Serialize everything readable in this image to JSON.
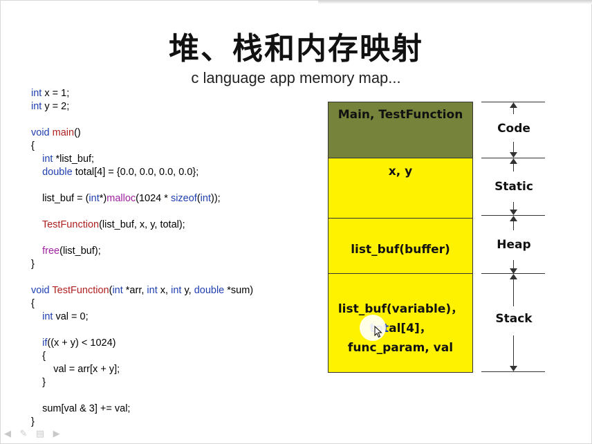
{
  "slide": {
    "title": "堆、栈和内存映射",
    "subtitle": "c language app memory map..."
  },
  "code": {
    "line_01": {
      "t1": "int",
      "t2": " x = 1;"
    },
    "line_02": {
      "t1": "int",
      "t2": " y = 2;"
    },
    "line_04": {
      "t1": "void ",
      "t2": "main",
      "t3": "()"
    },
    "line_05": "{",
    "line_06": {
      "t1": "    int",
      "t2": " *list_buf;"
    },
    "line_07": {
      "t1": "    double",
      "t2": " total[4] = {0.0, 0.0, 0.0, 0.0};"
    },
    "line_09": {
      "t1": "    list_buf = (",
      "t2": "int",
      "t3": "*)",
      "t4": "malloc",
      "t5": "(1024 * ",
      "t6": "sizeof",
      "t7": "(",
      "t8": "int",
      "t9": "));"
    },
    "line_11": {
      "t1": "    ",
      "t2": "TestFunction",
      "t3": "(list_buf, x, y, total);"
    },
    "line_13": {
      "t1": "    ",
      "t2": "free",
      "t3": "(list_buf);"
    },
    "line_14": "}",
    "line_16": {
      "t1": "void ",
      "t2": "TestFunction",
      "t3": "(",
      "t4": "int",
      "t5": " *arr, ",
      "t6": "int",
      "t7": " x, ",
      "t8": "int",
      "t9": " y, ",
      "t10": "double",
      "t11": " *sum)"
    },
    "line_17": "{",
    "line_18": {
      "t1": "    int",
      "t2": " val = 0;"
    },
    "line_20": {
      "t1": "    if",
      "t2": "((x + y) < 1024)"
    },
    "line_21": "    {",
    "line_22": "        val = arr[x + y];",
    "line_23": "    }",
    "line_25": "    sum[val & 3] += val;",
    "line_26": "}"
  },
  "memory_map": {
    "code_region": "Main, TestFunction",
    "static_region": "x, y",
    "heap_region": "list_buf(buffer)",
    "stack_region": {
      "line1": "list_buf(variable)，",
      "line2_a": "tot",
      "line2_b": "al[4]，",
      "line3": "func_param, val"
    }
  },
  "axis": {
    "code": "Code",
    "static": "Static",
    "heap": "Heap",
    "stack": "Stack"
  },
  "colors": {
    "code_region": "#76833a",
    "data_region": "#fff200",
    "keyword": "#1f3fb0",
    "function": "#b02020",
    "builtin": "#a020a0"
  },
  "icons": [
    "cursor-arrow-icon",
    "prev-slide-icon",
    "pen-icon",
    "menu-icon",
    "next-slide-icon"
  ]
}
